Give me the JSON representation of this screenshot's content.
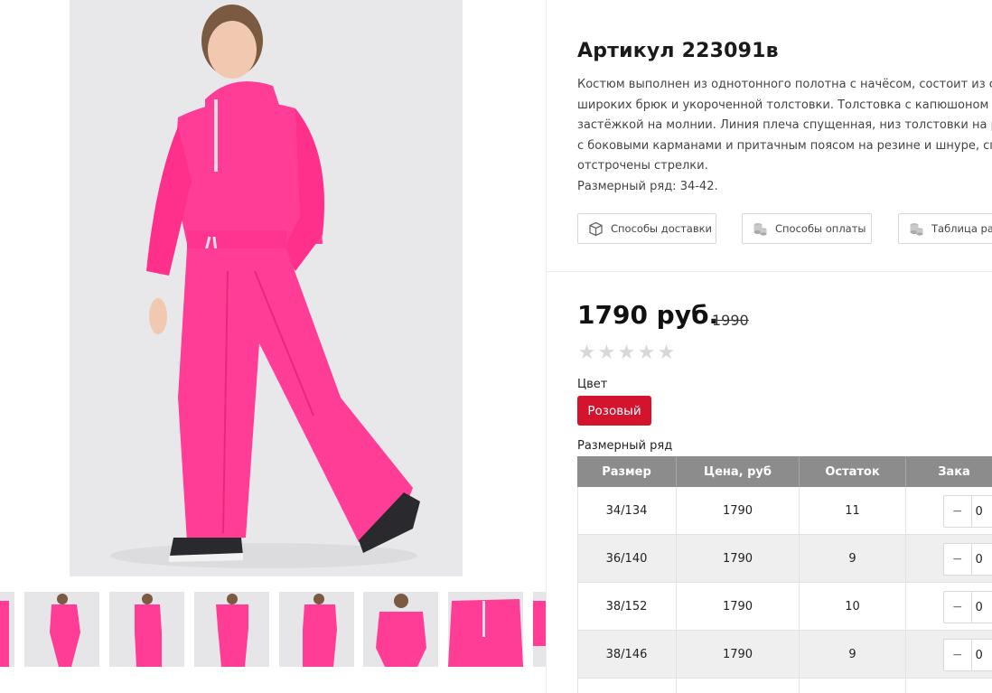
{
  "product": {
    "title": "Артикул 223091в",
    "description_lines": [
      "Костюм выполнен из однотонного полотна с начёсом, состоит из св",
      "широких брюк и укороченной толстовки. Толстовка с капюшоном и",
      "застёжкой на молнии. Линия плеча спущенная, низ толстовки на ре",
      "с боковыми карманами и притачным поясом на резине и шнуре, спе",
      "отстрочены стрелки.",
      "Размерный ряд: 34-42."
    ],
    "buttons": {
      "delivery": "Способы доставки",
      "payment": "Способы оплаты",
      "sizes": "Таблица раз"
    },
    "price": "1790 руб.",
    "old_price": "1990",
    "rating_stars": 0,
    "color_label": "Цвет",
    "color_value": "Розовый",
    "size_label": "Размерный ряд"
  },
  "size_table": {
    "headers": [
      "Размер",
      "Цена, руб",
      "Остаток",
      "Зака"
    ],
    "rows": [
      {
        "size": "34/134",
        "price": "1790",
        "stock": "11",
        "minus": "−",
        "qty": "0"
      },
      {
        "size": "36/140",
        "price": "1790",
        "stock": "9",
        "minus": "−",
        "qty": "0"
      },
      {
        "size": "38/152",
        "price": "1790",
        "stock": "10",
        "minus": "−",
        "qty": "0"
      },
      {
        "size": "38/146",
        "price": "1790",
        "stock": "9",
        "minus": "−",
        "qty": "0"
      }
    ]
  },
  "colors": {
    "accent": "#d4142d",
    "garment": "#ff3d96",
    "table_header": "#8c8c8c"
  },
  "icons": {
    "delivery": "box-icon",
    "payment": "coins-icon",
    "sizes": "coins-icon"
  }
}
